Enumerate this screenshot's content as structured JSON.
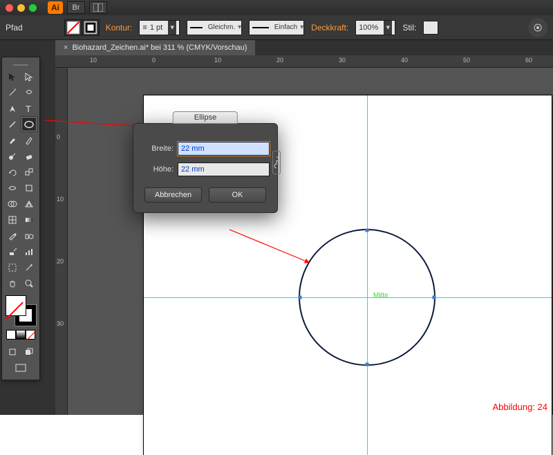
{
  "window": {
    "app": "Ai",
    "br": "Br"
  },
  "path_label": "Pfad",
  "control": {
    "kontur": "Kontur:",
    "stroke_weight": "1 pt",
    "profile": "Gleichm.",
    "brush": "Einfach",
    "opacity_label": "Deckkraft:",
    "opacity_value": "100%",
    "style_label": "Stil:"
  },
  "doc_tab": {
    "title": "Biohazard_Zeichen.ai* bei 311 % (CMYK/Vorschau)"
  },
  "ruler_h": [
    "10",
    "0",
    "10",
    "20",
    "30",
    "40",
    "50",
    "60"
  ],
  "ruler_v": [
    "0",
    "10",
    "20",
    "30"
  ],
  "dialog": {
    "title": "Ellipse",
    "width_label": "Breite:",
    "width_value": "22 mm",
    "height_label": "Höhe:",
    "height_value": "22 mm",
    "cancel": "Abbrechen",
    "ok": "OK"
  },
  "canvas": {
    "center_label": "Mitte"
  },
  "caption": "Abbildung: 24"
}
